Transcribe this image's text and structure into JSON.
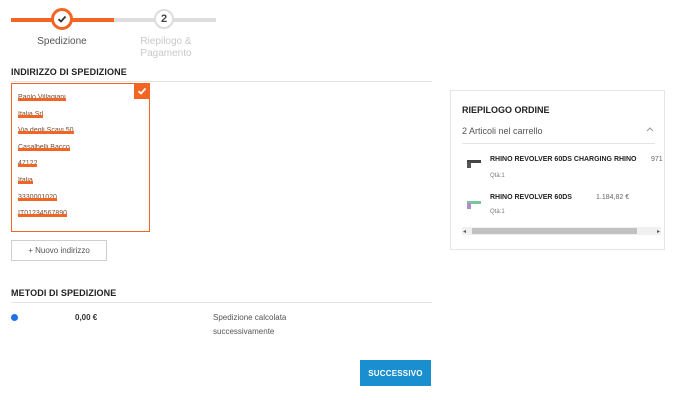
{
  "stepper": {
    "steps": [
      {
        "number": "",
        "label": "Spedizione",
        "active": true
      },
      {
        "number": "2",
        "label": "Riepilogo &\nPagamento",
        "active": false
      }
    ],
    "active_color": "#f26522",
    "inactive_color": "#dddddd"
  },
  "address_section": {
    "title": "INDIRIZZO DI SPEDIZIONE",
    "address_lines": [
      "Paolo Villagiani",
      "Italia Srl",
      "Via degli Scavi 50",
      "Casalbelli Bacco",
      "47122",
      "Italia",
      "3330001020",
      "IT01234567890"
    ],
    "selected": true,
    "new_address_button": "+ Nuovo indirizzo"
  },
  "shipping_methods": {
    "title": "METODI DI SPEDIZIONE",
    "options": [
      {
        "price": "0,00 €",
        "description": "Spedizione calcolata successivamente",
        "selected": true
      }
    ]
  },
  "next_button": "SUCCESSIVO",
  "order_summary": {
    "title": "RIEPILOGO ORDINE",
    "cart_count": "2 Articoli nel carrello",
    "items": [
      {
        "name": "RHINO REVOLVER 60DS CHARGING RHINO",
        "price": "971",
        "qty": "Qtà:1"
      },
      {
        "name": "RHINO REVOLVER 60DS",
        "price": "1.184,82 €",
        "qty": "Qtà:1"
      }
    ]
  }
}
